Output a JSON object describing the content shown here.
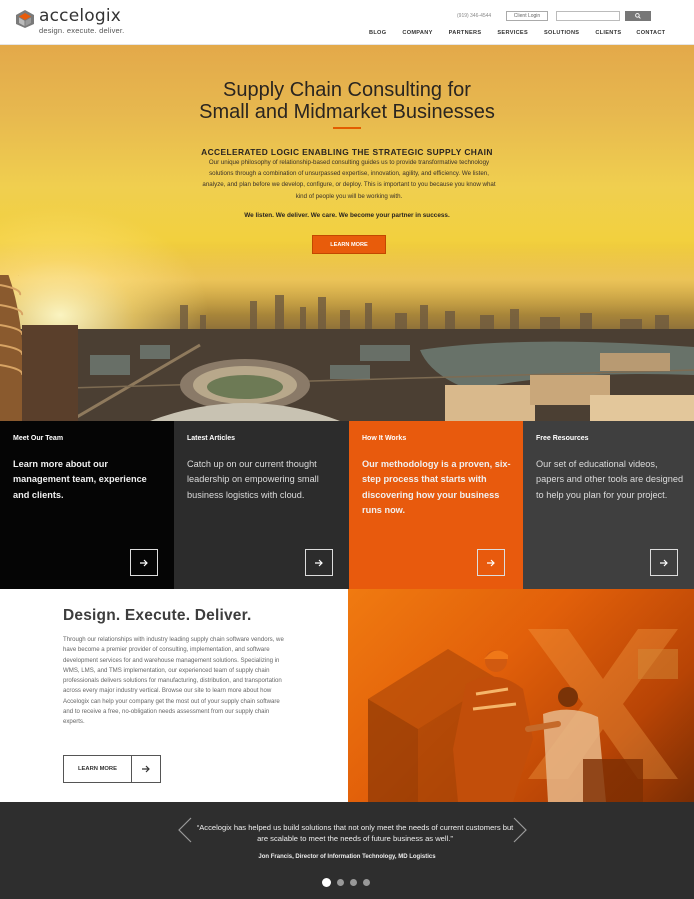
{
  "header": {
    "logo_name": "accelogix",
    "logo_tagline": "design. execute. deliver.",
    "phone": "(919) 346-4544",
    "client_login": "Client Login",
    "search_placeholder": "",
    "search_button_icon": "search-icon",
    "nav": [
      "BLOG",
      "COMPANY",
      "PARTNERS",
      "SERVICES",
      "SOLUTIONS",
      "CLIENTS",
      "CONTACT"
    ]
  },
  "hero": {
    "title_line1": "Supply Chain Consulting for",
    "title_line2": "Small and Midmarket Businesses",
    "subtitle": "ACCELERATED LOGIC ENABLING THE STRATEGIC SUPPLY CHAIN",
    "body": "Our unique philosophy of relationship-based consulting guides us to provide transformative technology solutions through a combination of unsurpassed expertise, innovation, agility, and efficiency. We listen, analyze, and plan before we develop, configure, or deploy. This is important to you because you know what kind of people you will be working with.",
    "tagline": "We listen. We deliver. We care. We become your partner in success.",
    "button": "LEARN MORE"
  },
  "tiles": [
    {
      "heading": "Meet Our Team",
      "body": "Learn more about our management team, experience and clients."
    },
    {
      "heading": "Latest Articles",
      "body": "Catch up on our current thought leadership on empowering small business logistics with cloud."
    },
    {
      "heading": "How It Works",
      "body": "Our methodology is a proven, six-step process that starts with discovering how your business runs now."
    },
    {
      "heading": "Free Resources",
      "body": "Our set of educational videos, papers and other tools are designed to help you plan for your project."
    }
  ],
  "design": {
    "title": "Design. Execute. Deliver.",
    "body": "Through our relationships with industry leading supply chain software vendors, we have become a premier provider of consulting, implementation, and software development services for  and warehouse management solutions. Specializing in WMS, LMS, and TMS implementation, our experienced team of supply chain professionals delivers solutions for manufacturing, distribution, and transportation across every major industry vertical. Browse our site to learn more about how Accelogix can help your company get the most out of your supply chain software and  to receive a free, no-obligation needs assessment from our supply chain experts.",
    "button": "LEARN MORE"
  },
  "testimonial": {
    "quote": "“Accelogix has helped us build solutions that not only meet the needs of current customers but are scalable to meet the needs of future business as well.”",
    "author": "Jon Francis, Director of Information Technology, MD Logistics",
    "active_slide": 1,
    "slide_count": 4
  },
  "colors": {
    "accent": "#e85c0b",
    "tile_black": "#050505",
    "tile_dark": "#2c2c2c",
    "tile_orange": "#e85a0d",
    "tile_gray": "#3f3f3f",
    "footer_bg": "#2e2e2e"
  }
}
